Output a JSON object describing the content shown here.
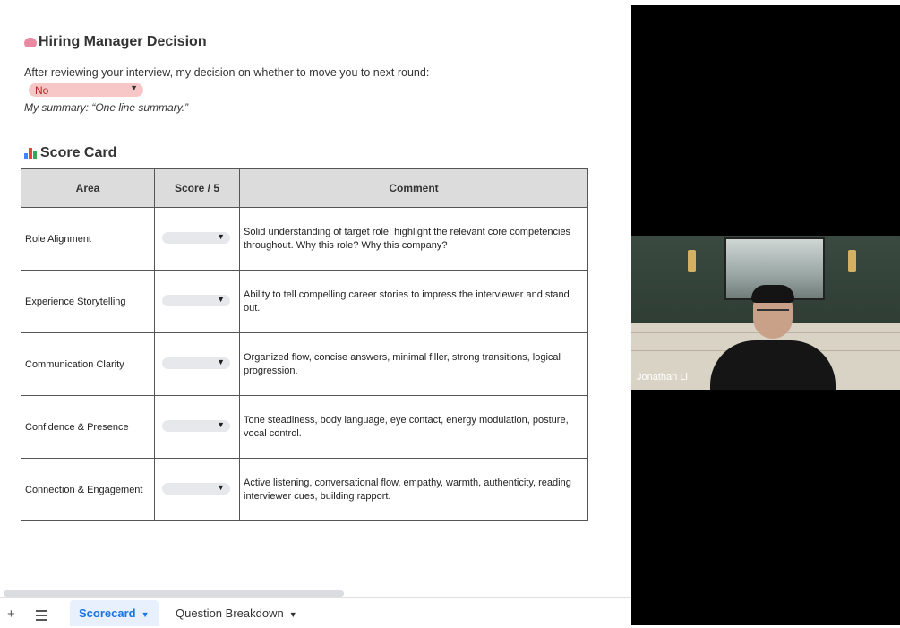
{
  "hiring": {
    "title": "Hiring Manager Decision",
    "decision_prompt": "After reviewing your interview, my decision on whether to move you to next round:",
    "decision_value": "No",
    "summary": "My summary: “One line summary.”"
  },
  "scorecard": {
    "title": "Score Card",
    "headers": {
      "area": "Area",
      "score": "Score / 5",
      "comment": "Comment"
    },
    "rows": [
      {
        "area": "Role Alignment",
        "comment": "Solid understanding of target role; highlight the relevant core competencies throughout. Why this role? Why this company?"
      },
      {
        "area": "Experience Storytelling",
        "comment": "Ability to tell compelling career stories to impress the interviewer and stand out."
      },
      {
        "area": "Communication Clarity",
        "comment": "Organized flow, concise answers, minimal filler, strong transitions, logical progression."
      },
      {
        "area": "Confidence & Presence",
        "comment": "Tone steadiness, body language, eye contact, energy modulation, posture, vocal control."
      },
      {
        "area": "Connection & Engagement",
        "comment": "Active listening, conversational flow, empathy, warmth, authenticity, reading interviewer cues, building rapport."
      }
    ]
  },
  "sheet_tabs": {
    "add_icon": "+",
    "active_tab": "Scorecard",
    "second_tab": "Question Breakdown"
  },
  "video": {
    "participant_name": "Jonathan Li"
  },
  "colors": {
    "decision_no_bg": "#f7c6c6",
    "active_tab_text": "#1a73e8",
    "header_bg": "#dcdcdc"
  },
  "icons": [
    "brain-icon",
    "bar-chart-icon",
    "dropdown-caret-icon",
    "add-sheet-icon",
    "all-sheets-menu-icon"
  ]
}
